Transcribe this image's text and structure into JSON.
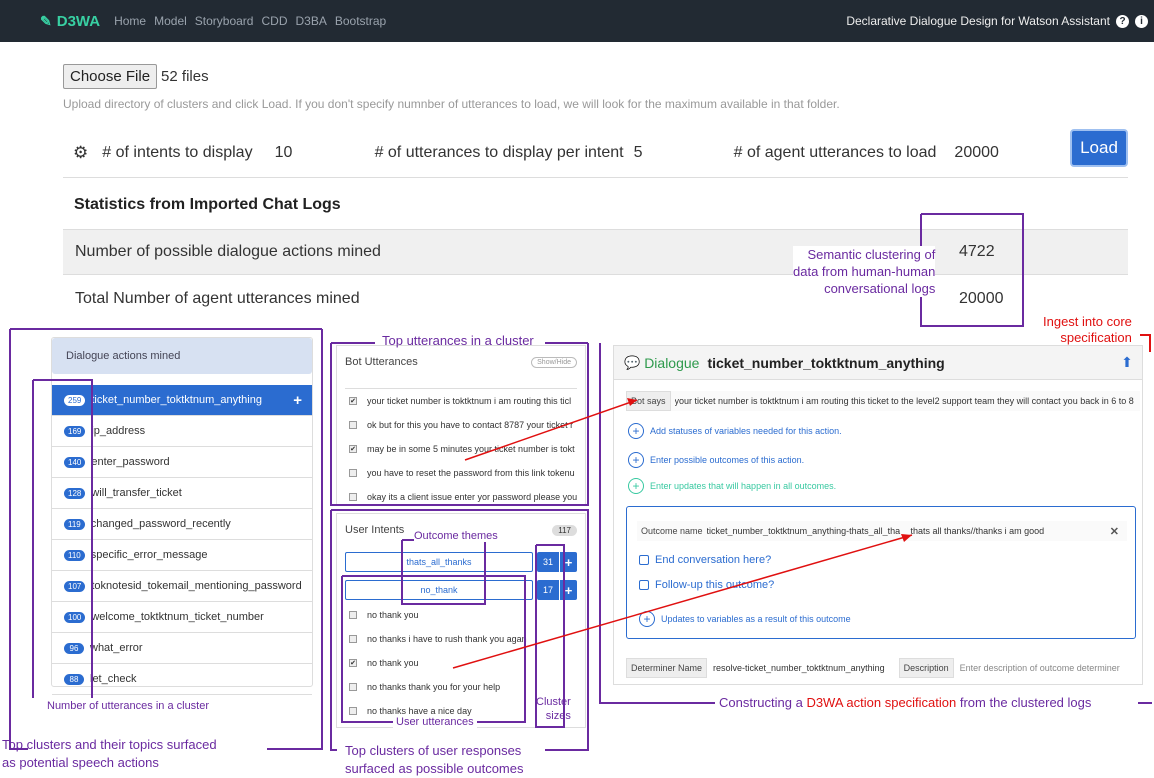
{
  "navbar": {
    "brand": "D3WA",
    "links": [
      "Home",
      "Model",
      "Storyboard",
      "CDD",
      "D3BA",
      "Bootstrap"
    ],
    "right_text": "Declarative Dialogue Design for Watson Assistant"
  },
  "upload": {
    "choose_file_label": "Choose File",
    "file_count": "52 files",
    "hint": "Upload directory of clusters and click Load. If you don't specify numnber of utterances to load, we will look for the maximum available in that folder."
  },
  "settings": {
    "intents_label": "# of intents to display",
    "intents_value": "10",
    "utterances_label": "# of utterances to display per intent",
    "utterances_value": "5",
    "agent_label": "# of agent utterances to load",
    "agent_value": "20000",
    "load_label": "Load"
  },
  "stats": {
    "title": "Statistics from Imported Chat Logs",
    "rows": [
      {
        "label": "Number of possible dialogue actions mined",
        "value": "4722"
      },
      {
        "label": "Total Number of agent utterances mined",
        "value": "20000"
      }
    ]
  },
  "actions_panel": {
    "header": "Dialogue actions mined",
    "items": [
      {
        "count": "259",
        "label": "ticket_number_toktktnum_anything"
      },
      {
        "count": "169",
        "label": "ip_address"
      },
      {
        "count": "140",
        "label": "enter_password"
      },
      {
        "count": "128",
        "label": "will_transfer_ticket"
      },
      {
        "count": "119",
        "label": "changed_password_recently"
      },
      {
        "count": "110",
        "label": "specific_error_message"
      },
      {
        "count": "107",
        "label": "toknotesid_tokemail_mentioning_password"
      },
      {
        "count": "100",
        "label": "welcome_toktktnum_ticket_number"
      },
      {
        "count": "96",
        "label": "what_error"
      },
      {
        "count": "88",
        "label": "let_check"
      }
    ]
  },
  "bot_panel": {
    "header": "Bot Utterances",
    "toggle": "Show/Hide",
    "items": [
      {
        "checked": true,
        "text": "your ticket number is toktktnum i am routing this ticl"
      },
      {
        "checked": false,
        "text": "ok but for this you have to contact 8787 your ticket r"
      },
      {
        "checked": true,
        "text": "may be in some 5 minutes your ticket number is tokt"
      },
      {
        "checked": false,
        "text": "you have to reset the password from this link tokenu"
      },
      {
        "checked": false,
        "text": "okay its a client issue enter yor password please you"
      }
    ]
  },
  "intents_panel": {
    "header": "User Intents",
    "count": "117",
    "themes": [
      {
        "label": "thats_all_thanks",
        "count": "31"
      },
      {
        "label": "no_thank",
        "count": "17"
      }
    ],
    "items": [
      {
        "checked": false,
        "text": "no thank you"
      },
      {
        "checked": false,
        "text": "no thanks i have to rush thank you agan"
      },
      {
        "checked": true,
        "text": "no thank you"
      },
      {
        "checked": false,
        "text": "no thanks thank you for your help"
      },
      {
        "checked": false,
        "text": "no thanks have a nice day"
      }
    ]
  },
  "dialogue_panel": {
    "label": "Dialogue",
    "name": "ticket_number_toktktnum_anything",
    "bot_says_tag": "Bot says",
    "bot_says_text": "your ticket number is toktktnum i am routing this ticket to the level2 support team they will contact you back in 6 to 8",
    "add_statuses": "Add statuses of variables needed for this action.",
    "add_outcomes": "Enter possible outcomes of this action.",
    "add_updates": "Enter updates that will happen in all outcomes.",
    "outcome": {
      "name_tag": "Outcome name",
      "name_value": "ticket_number_toktktnum_anything-thats_all_tha",
      "desc_value": "thats all thanks//thanks i am good",
      "end_conv": "End conversation here?",
      "follow_up": "Follow-up this outcome?",
      "updates": "Updates to variables as a result of this outcome"
    },
    "determiner_tag": "Determiner Name",
    "determiner_value": "resolve-ticket_number_toktktnum_anything",
    "description_tag": "Description",
    "description_placeholder": "Enter description of outcome determiner"
  },
  "annotations": {
    "semantic": "Semantic clustering of\ndata from human-human\nconversational logs",
    "ingest": "Ingest into core\nspecification",
    "top_utterances": "Top utterances in a cluster",
    "outcome_themes": "Outcome themes",
    "num_utterances": "Number of utterances in a cluster",
    "cluster_sizes": "Cluster\nsizes",
    "user_utterances": "User utterances",
    "top_clusters_left": "Top clusters and their topics surfaced\nas potential speech actions",
    "top_clusters_user": "Top clusters of user responses\nsurfaced as possible outcomes",
    "constructing_pre": "Constructing a ",
    "constructing_red": "D3WA action specification",
    "constructing_post": " from the clustered logs"
  },
  "colors": {
    "navbar": "#222a33",
    "brand": "#38d0a3",
    "primary": "#2b6cd0",
    "annotation": "#6a2aa0",
    "annotation_red": "#e01010",
    "dialogue_green": "#2e9a4c"
  }
}
